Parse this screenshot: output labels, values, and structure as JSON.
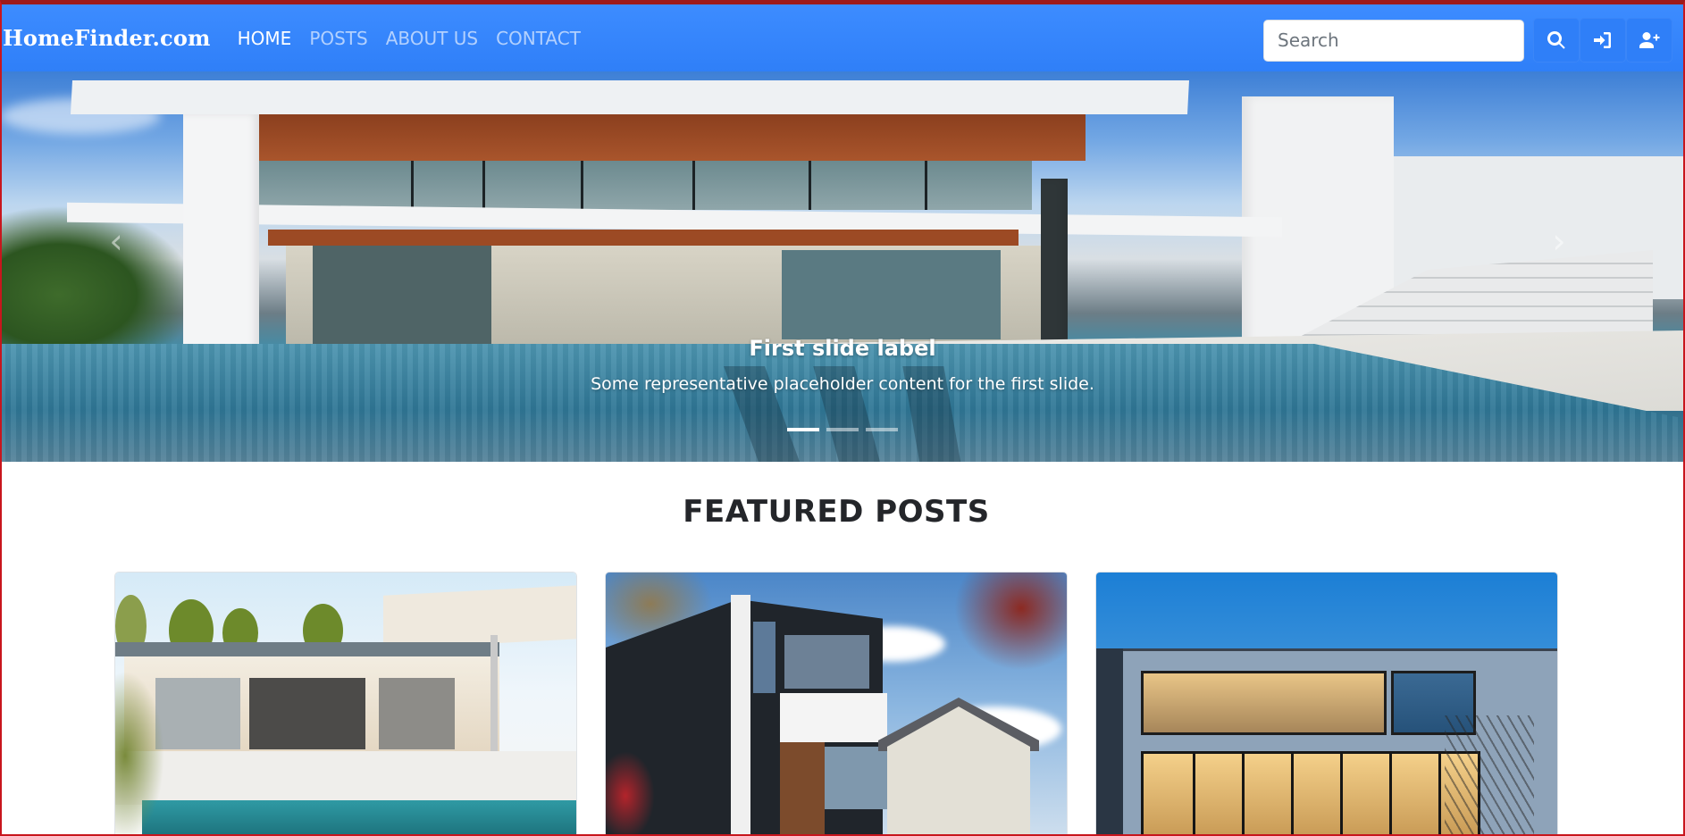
{
  "navbar": {
    "brand": "HomeFinder.com",
    "links": [
      {
        "label": "HOME",
        "active": true
      },
      {
        "label": "POSTS",
        "active": false
      },
      {
        "label": "ABOUT US",
        "active": false
      },
      {
        "label": "CONTACT",
        "active": false
      }
    ],
    "search": {
      "placeholder": "Search",
      "value": ""
    },
    "buttons": [
      {
        "icon": "search-icon"
      },
      {
        "icon": "sign-in-icon"
      },
      {
        "icon": "user-plus-icon"
      }
    ],
    "color": "#2f7ff8"
  },
  "carousel": {
    "caption_title": "First slide label",
    "caption_text": "Some representative placeholder content for the first slide.",
    "prev_icon": "chevron-left-icon",
    "next_icon": "chevron-right-icon",
    "prev_glyph": "‹",
    "next_glyph": "›",
    "slide_count": 3,
    "active_index": 0
  },
  "featured": {
    "title": "FEATURED POSTS",
    "cards": [
      {
        "image": "modern-house-with-pool-photo"
      },
      {
        "image": "modern-townhouse-photo"
      },
      {
        "image": "lit-modern-house-at-dusk-photo"
      }
    ]
  }
}
